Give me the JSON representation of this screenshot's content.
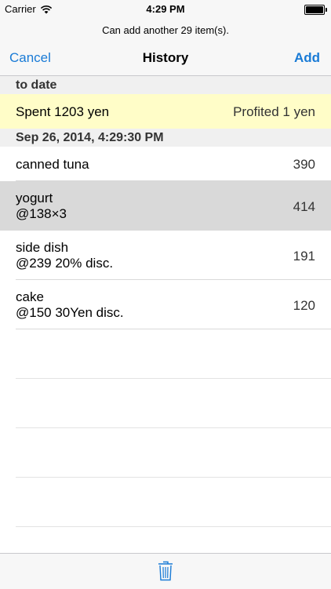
{
  "status_bar": {
    "carrier": "Carrier",
    "time": "4:29 PM",
    "battery_level": 1.0
  },
  "nav": {
    "prompt": "Can add another 29 item(s).",
    "cancel_label": "Cancel",
    "title": "History",
    "add_label": "Add"
  },
  "sections": {
    "to_date": "to date",
    "summary_spent": "Spent 1203 yen",
    "summary_profit": "Profited 1 yen",
    "session_date": "Sep 26, 2014, 4:29:30 PM"
  },
  "items": [
    {
      "name": "canned tuna",
      "detail": "",
      "value": "390"
    },
    {
      "name": "yogurt",
      "detail": "@138×3",
      "value": "414"
    },
    {
      "name": "side dish",
      "detail": "@239 20% disc.",
      "value": "191"
    },
    {
      "name": "cake",
      "detail": "@150 30Yen disc.",
      "value": "120"
    }
  ],
  "icons": {
    "wifi": "wifi-icon",
    "battery": "battery-icon",
    "trash": "trash-icon"
  },
  "colors": {
    "accent": "#1a7bd6",
    "summary_bg": "#fffdc8",
    "selected_row": "#d9d9d9"
  }
}
